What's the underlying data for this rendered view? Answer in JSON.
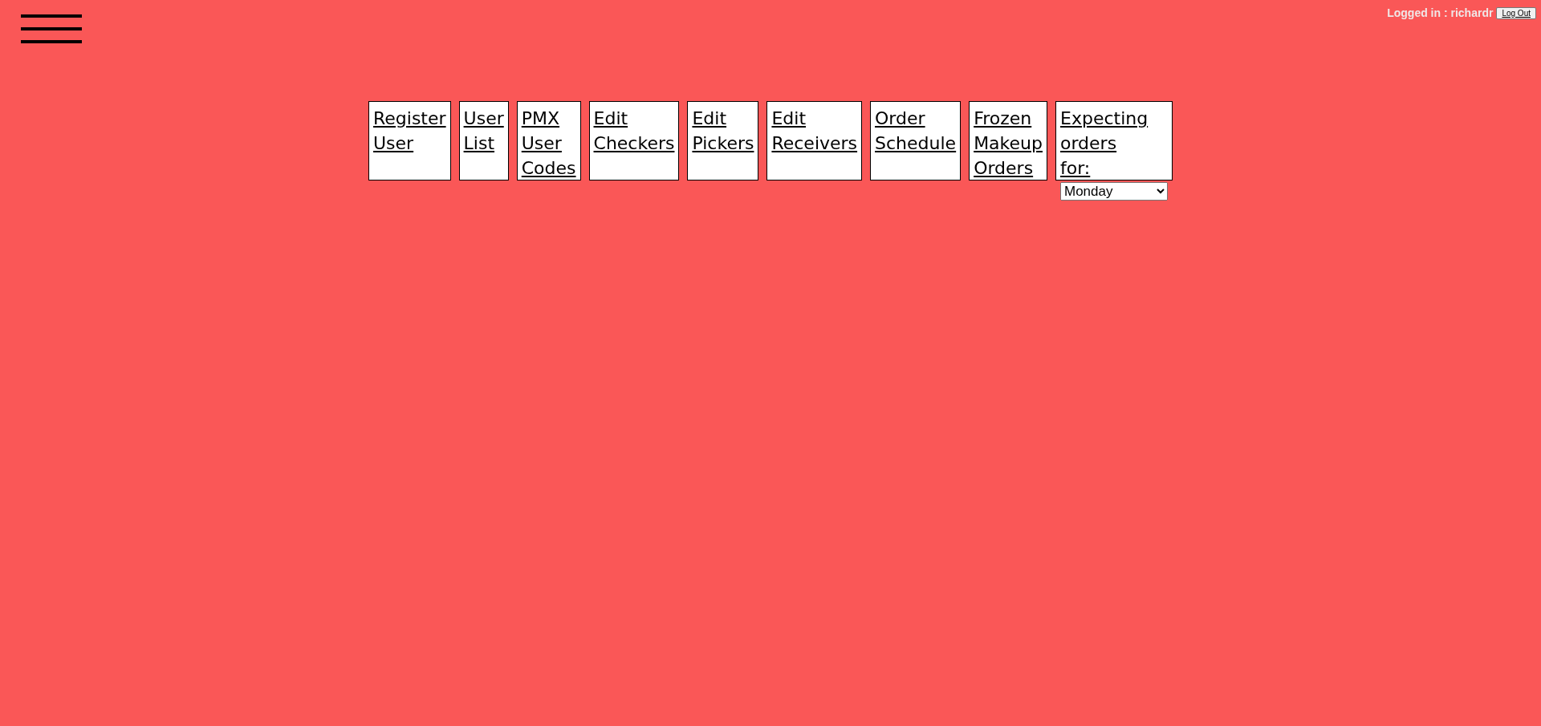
{
  "header": {
    "login_label": "Logged in : richardr",
    "logout_button": "Log Out"
  },
  "nav_links": [
    {
      "kind": "link",
      "label": "Register User"
    },
    {
      "kind": "link",
      "label": "User List"
    },
    {
      "kind": "link",
      "label": "PMX User Codes"
    },
    {
      "kind": "link",
      "label": "Edit Checkers"
    },
    {
      "kind": "link",
      "label": "Edit Pickers"
    },
    {
      "kind": "link",
      "label": "Edit Receivers"
    },
    {
      "kind": "link",
      "label": "Order Schedule"
    },
    {
      "kind": "link",
      "label": "Frozen Makeup Orders"
    },
    {
      "kind": "select",
      "label": "Expecting orders for:",
      "value": "Monday"
    }
  ]
}
